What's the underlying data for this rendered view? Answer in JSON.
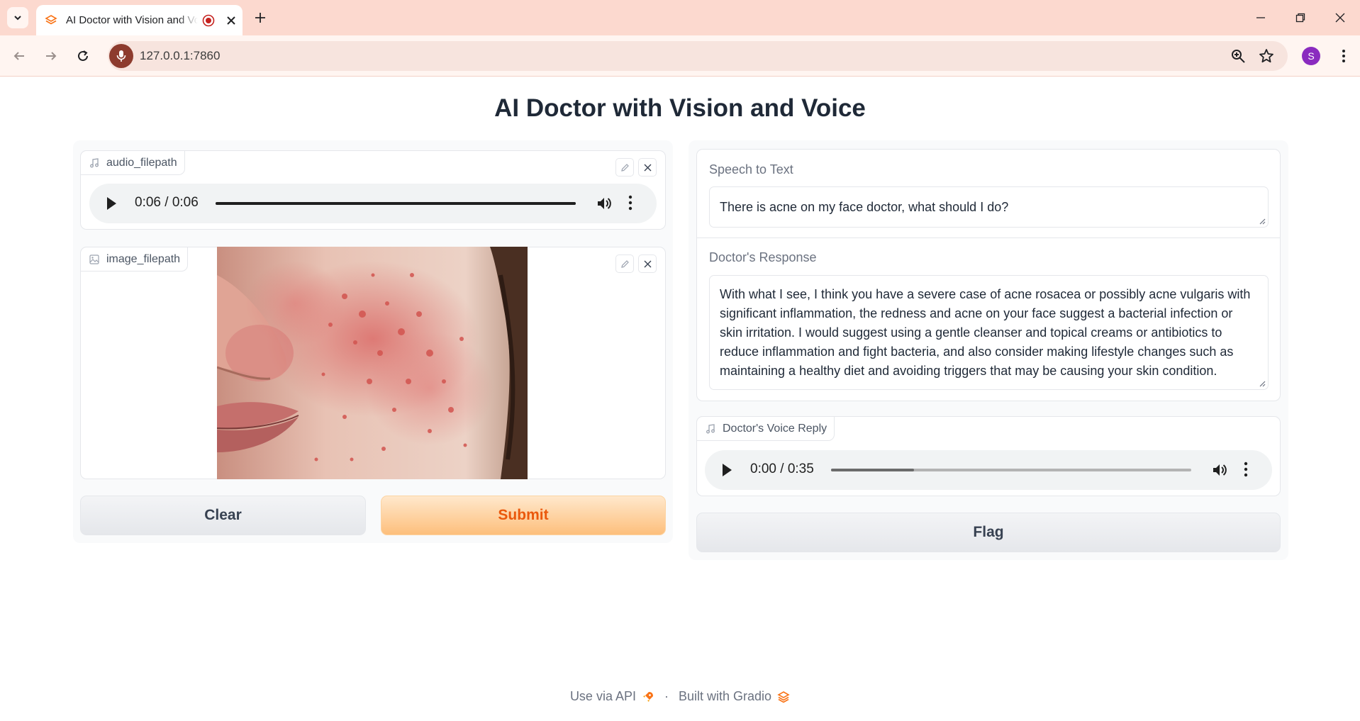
{
  "browser": {
    "tab_title": "AI Doctor with Vision and Voice",
    "url": "127.0.0.1:7860",
    "profile_initial": "S"
  },
  "page": {
    "title": "AI Doctor with Vision and Voice"
  },
  "inputs": {
    "audio": {
      "label": "audio_filepath",
      "time": "0:06 / 0:06",
      "progress": 1.0
    },
    "image": {
      "label": "image_filepath"
    },
    "clear_label": "Clear",
    "submit_label": "Submit"
  },
  "outputs": {
    "speech_label": "Speech to Text",
    "speech_text": "There is acne on my face doctor, what should I do?",
    "response_label": "Doctor's Response",
    "response_text": "With what I see, I think you have a severe case of acne rosacea or possibly acne vulgaris with significant inflammation, the redness and acne on your face suggest a bacterial infection or skin irritation. I would suggest using a gentle cleanser and topical creams or antibiotics to reduce inflammation and fight bacteria, and also consider making lifestyle changes such as maintaining a healthy diet and avoiding triggers that may be causing your skin condition.",
    "voice": {
      "label": "Doctor's Voice Reply",
      "time": "0:00 / 0:35",
      "buffered": 0.23
    },
    "flag_label": "Flag"
  },
  "footer": {
    "api_label": "Use via API",
    "separator": "·",
    "built_label": "Built with Gradio"
  },
  "colors": {
    "accent": "#ea580c",
    "tabbar": "#fcd9cf"
  }
}
